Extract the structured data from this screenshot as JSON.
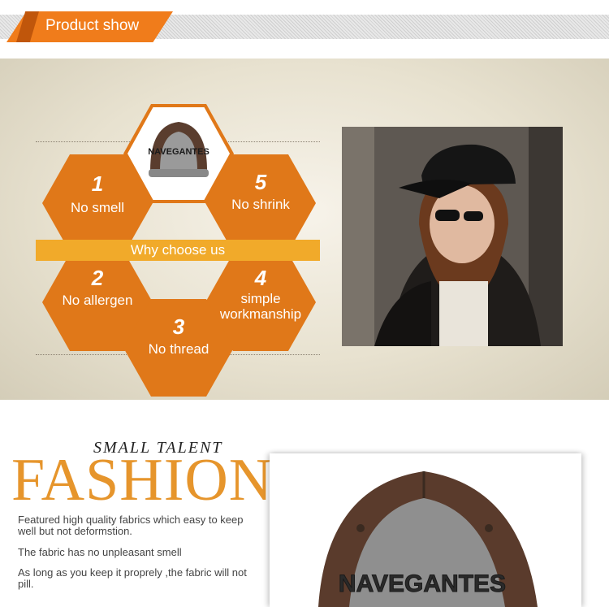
{
  "header": {
    "title": "Product show"
  },
  "why": {
    "bar_label": "Why choose us",
    "features": [
      {
        "num": "1",
        "label": "No smell"
      },
      {
        "num": "2",
        "label": "No allergen"
      },
      {
        "num": "3",
        "label": "No thread"
      },
      {
        "num": "4",
        "label_line1": "simple",
        "label_line2": "workmanship"
      },
      {
        "num": "5",
        "label": "No shrink"
      }
    ],
    "cap_text": "NAVEGANTES"
  },
  "fashion": {
    "small_title": "SMALL TALENT",
    "big_title": "FASHION",
    "paragraphs": [
      "Featured high quality fabrics which easy to keep well but not deformstion.",
      "The fabric has no unpleasant smell",
      "As long as you keep it proprely ,the fabric will not pill."
    ],
    "cap_text": "NAVEGANTES"
  },
  "colors": {
    "accent": "#f07c1b",
    "hex": "#e07819",
    "bar": "#f1aa2a",
    "fashion": "#e6952c"
  }
}
